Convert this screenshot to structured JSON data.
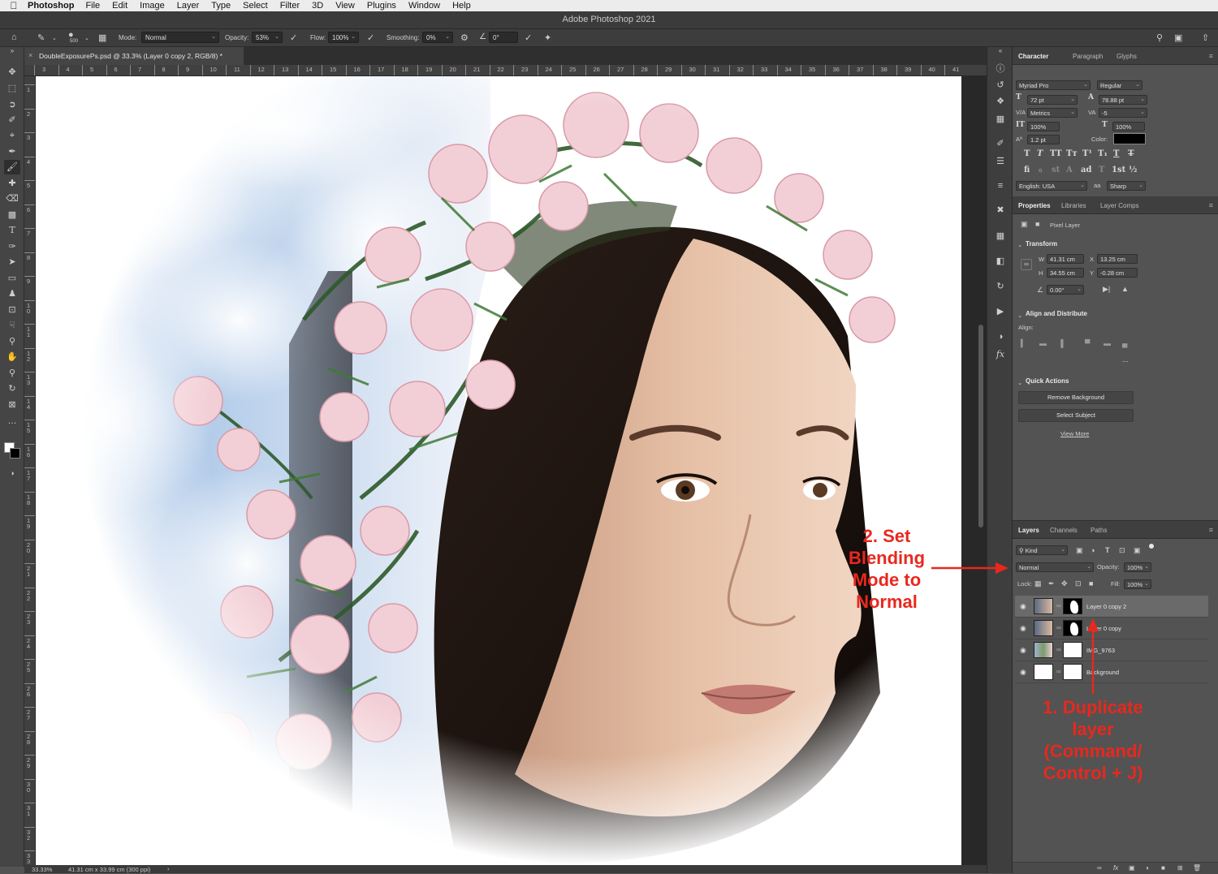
{
  "menubar": {
    "app_name": "Photoshop",
    "items": [
      "File",
      "Edit",
      "Image",
      "Layer",
      "Type",
      "Select",
      "Filter",
      "3D",
      "View",
      "Plugins",
      "Window",
      "Help"
    ]
  },
  "window_title": "Adobe Photoshop 2021",
  "options_bar": {
    "brush_size": "500",
    "mode_label": "Mode:",
    "mode_value": "Normal",
    "opacity_label": "Opacity:",
    "opacity_value": "53%",
    "flow_label": "Flow:",
    "flow_value": "100%",
    "smoothing_label": "Smoothing:",
    "smoothing_value": "0%",
    "angle_value": "0°"
  },
  "document_tab": "DoubleExposurePs.psd @ 33.3% (Layer 0 copy 2, RGB/8) *",
  "ruler_top": [
    "3",
    "4",
    "5",
    "6",
    "7",
    "8",
    "9",
    "10",
    "11",
    "12",
    "13",
    "14",
    "15",
    "16",
    "17",
    "18",
    "19",
    "20",
    "21",
    "22",
    "23",
    "24",
    "25",
    "26",
    "27",
    "28",
    "29",
    "30",
    "31",
    "32",
    "33",
    "34",
    "35",
    "36",
    "37",
    "38",
    "39",
    "40",
    "41"
  ],
  "ruler_left": [
    "1",
    "2",
    "3",
    "4",
    "5",
    "6",
    "7",
    "8",
    "9",
    "1 0",
    "1 1",
    "1 2",
    "1 3",
    "1 4",
    "1 5",
    "1 6",
    "1 7",
    "1 8",
    "1 9",
    "2 0",
    "2 1",
    "2 2",
    "2 3",
    "2 4",
    "2 5",
    "2 6",
    "2 7",
    "2 8",
    "2 9",
    "3 0",
    "3 1",
    "3 2",
    "3 3"
  ],
  "status": {
    "zoom": "33.33%",
    "doc_size": "41.31 cm x 33.99 cm (300 ppi)"
  },
  "character_panel": {
    "tabs": [
      "Character",
      "Paragraph",
      "Glyphs"
    ],
    "font_family": "Myriad Pro",
    "font_style": "Regular",
    "font_size": "72 pt",
    "leading": "78.88 pt",
    "kerning": "Metrics",
    "tracking": "-5",
    "vertical_scale": "100%",
    "horizontal_scale": "100%",
    "baseline_shift": "1.2 pt",
    "color_label": "Color:",
    "color_swatch": "#000000",
    "language": "English: USA",
    "antialias_label": "aa",
    "antialias": "Sharp"
  },
  "properties_panel": {
    "tabs": [
      "Properties",
      "Libraries",
      "Layer Comps"
    ],
    "layer_type": "Pixel Layer",
    "transform_title": "Transform",
    "w_label": "W",
    "w_value": "41.31 cm",
    "x_label": "X",
    "x_value": "13.25 cm",
    "h_label": "H",
    "h_value": "34.55 cm",
    "y_label": "Y",
    "y_value": "-0.28 cm",
    "angle_value": "0.00°",
    "align_title": "Align and Distribute",
    "align_label": "Align:",
    "more": "...",
    "quick_actions_title": "Quick Actions",
    "remove_bg": "Remove Background",
    "select_subject": "Select Subject",
    "view_more": "View More"
  },
  "layers_panel": {
    "tabs": [
      "Layers",
      "Channels",
      "Paths"
    ],
    "kind_label": "Kind",
    "blend_mode": "Normal",
    "opacity_label": "Opacity:",
    "opacity_value": "100%",
    "lock_label": "Lock:",
    "fill_label": "Fill:",
    "fill_value": "100%",
    "layers": [
      {
        "name": "Layer 0 copy 2",
        "selected": true
      },
      {
        "name": "Layer 0 copy",
        "selected": false
      },
      {
        "name": "IMG_9763",
        "selected": false
      },
      {
        "name": "Background",
        "selected": false
      }
    ],
    "footer_icons": [
      "link-icon",
      "fx-icon",
      "mask-icon",
      "adjustment-icon",
      "folder-icon",
      "new-layer-icon",
      "trash-icon"
    ]
  },
  "annotations": {
    "step2": [
      "2. Set",
      "Blending",
      "Mode to",
      "Normal"
    ],
    "step1": [
      "1. Duplicate",
      "layer",
      "(Command/",
      "Control + J)"
    ],
    "color": "#e8281e"
  }
}
